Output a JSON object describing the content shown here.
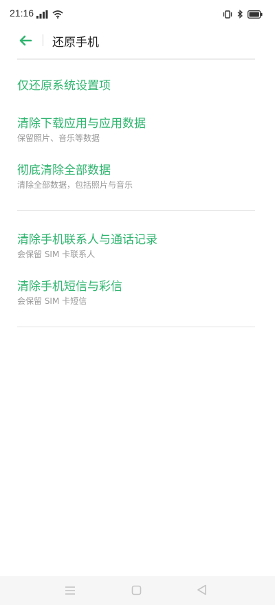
{
  "status_bar": {
    "time": "21:16",
    "icons": [
      "signal-icon",
      "wifi-icon",
      "vibrate-icon",
      "bluetooth-icon",
      "battery-icon"
    ]
  },
  "header": {
    "back_icon": "arrow-left-icon",
    "title": "还原手机"
  },
  "options": [
    {
      "title": "仅还原系统设置项",
      "subtitle": ""
    },
    {
      "title": "清除下载应用与应用数据",
      "subtitle": "保留照片、音乐等数据"
    },
    {
      "title": "彻底清除全部数据",
      "subtitle": "清除全部数据，包括照片与音乐"
    },
    {
      "title": "清除手机联系人与通话记录",
      "subtitle": "会保留 SIM 卡联系人"
    },
    {
      "title": "清除手机短信与彩信",
      "subtitle": "会保留 SIM 卡短信"
    }
  ],
  "nav_bar": {
    "icons": [
      "menu-icon",
      "home-icon",
      "back-icon"
    ]
  },
  "colors": {
    "accent": "#2fb56f",
    "subtitle": "#9a9a9a",
    "title": "#222222",
    "nav_background": "#f6f6f6"
  }
}
